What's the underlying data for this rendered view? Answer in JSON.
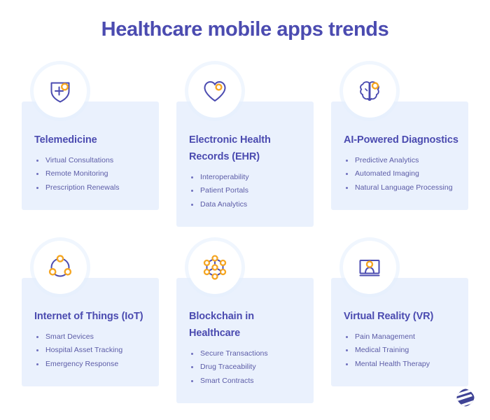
{
  "title": "Healthcare mobile apps trends",
  "colors": {
    "page_background": "#ffffff",
    "card_background": "#eaf1fd",
    "heading": "#4b4bb0",
    "body_text": "#5b5ba6",
    "icon_primary": "#4b4bb0",
    "icon_accent": "#f5a623",
    "logo": "#3f4395"
  },
  "cards": [
    {
      "icon": "shield-plus-icon",
      "title": "Telemedicine",
      "items": [
        "Virtual Consultations",
        "Remote Monitoring",
        "Prescription Renewals"
      ]
    },
    {
      "icon": "heart-icon",
      "title": "Electronic Health Records (EHR)",
      "items": [
        "Interoperability",
        "Patient Portals",
        "Data Analytics"
      ]
    },
    {
      "icon": "brain-icon",
      "title": "AI-Powered Diagnostics",
      "items": [
        "Predictive Analytics",
        "Automated Imaging",
        "Natural Language Processing"
      ]
    },
    {
      "icon": "network-circle-icon",
      "title": "Internet of Things (IoT)",
      "items": [
        "Smart Devices",
        "Hospital Asset Tracking",
        "Emergency Response"
      ]
    },
    {
      "icon": "blockchain-hexagon-icon",
      "title": "Blockchain in Healthcare",
      "items": [
        "Secure Transactions",
        "Drug Traceability",
        "Smart Contracts"
      ]
    },
    {
      "icon": "vr-screen-icon",
      "title": "Virtual Reality (VR)",
      "items": [
        "Pain Management",
        "Medical Training",
        "Mental Health Therapy"
      ]
    }
  ],
  "logo": {
    "name": "brand-logo-mark"
  }
}
